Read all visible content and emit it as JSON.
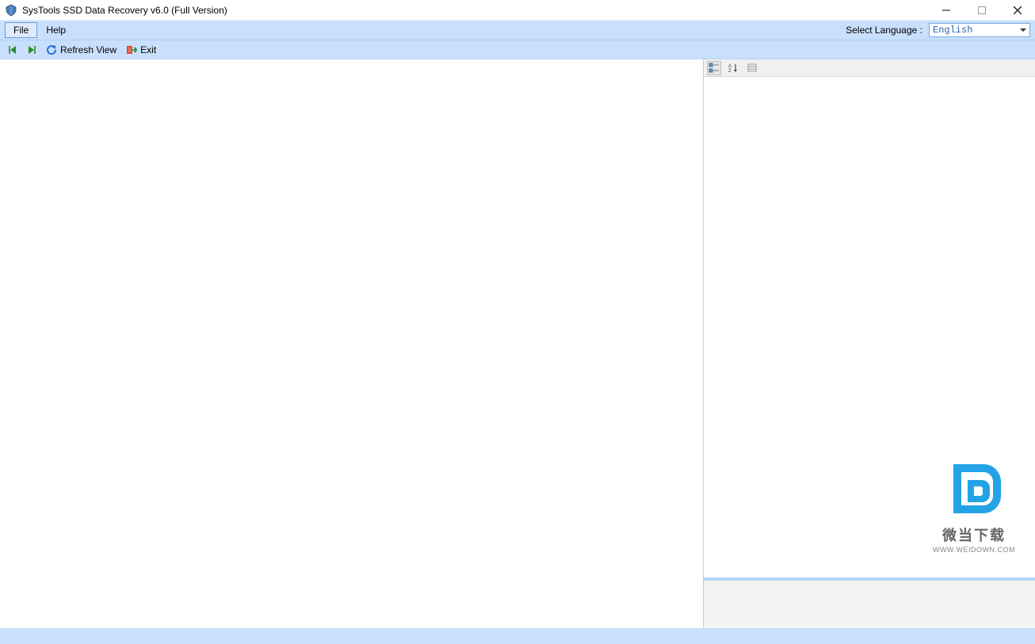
{
  "titlebar": {
    "title": "SysTools SSD Data Recovery v6.0 (Full Version)"
  },
  "menubar": {
    "file_label": "File",
    "help_label": "Help",
    "lang_label_text": "Select Language :",
    "lang_value": "English"
  },
  "toolbar": {
    "refresh_label": "Refresh View",
    "exit_label": "Exit"
  },
  "watermark": {
    "cn_text": "微当下载",
    "url_text": "WWW.WEIDOWN.COM"
  }
}
